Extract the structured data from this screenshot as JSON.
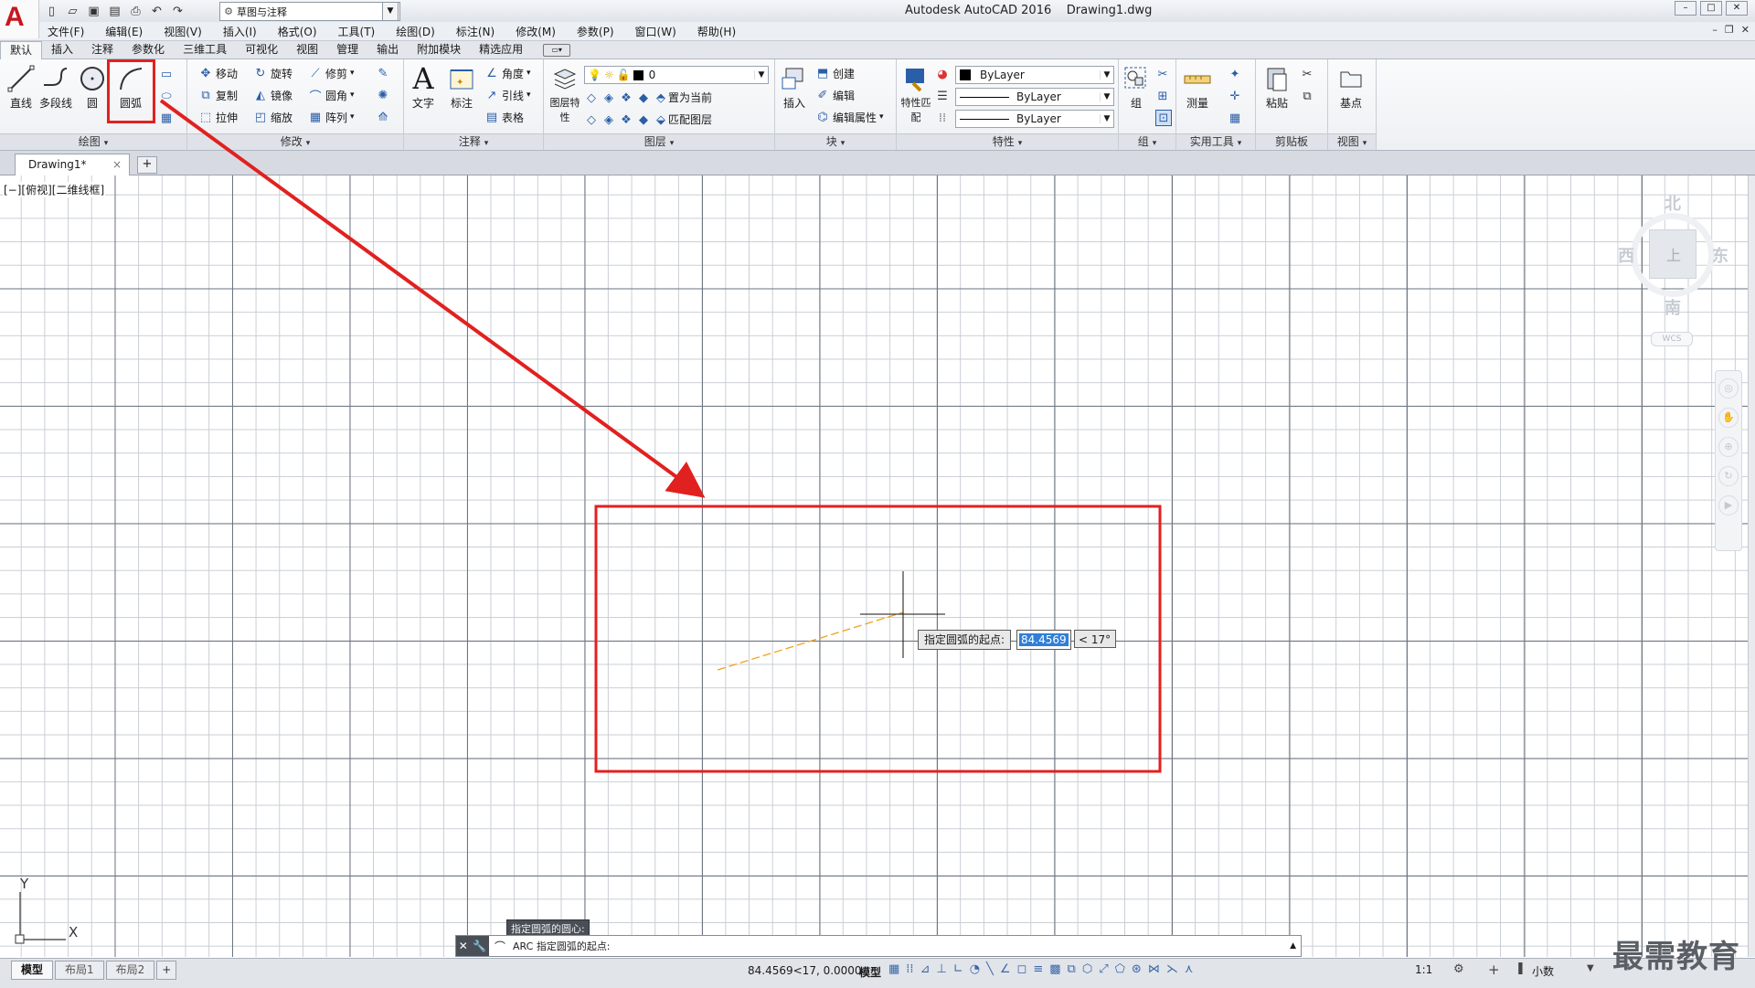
{
  "titlebar": {
    "app_title": "Autodesk AutoCAD 2016    Drawing1.dwg",
    "workspace": "草图与注释",
    "logo": "A"
  },
  "menu": [
    "文件(F)",
    "编辑(E)",
    "视图(V)",
    "插入(I)",
    "格式(O)",
    "工具(T)",
    "绘图(D)",
    "标注(N)",
    "修改(M)",
    "参数(P)",
    "窗口(W)",
    "帮助(H)"
  ],
  "ribbon_tabs": [
    "默认",
    "插入",
    "注释",
    "参数化",
    "三维工具",
    "可视化",
    "视图",
    "管理",
    "输出",
    "附加模块",
    "精选应用"
  ],
  "panels": {
    "draw": {
      "title": "绘图",
      "line": "直线",
      "polyline": "多段线",
      "circle": "圆",
      "arc": "圆弧"
    },
    "modify": {
      "title": "修改",
      "move": "移动",
      "rotate": "旋转",
      "trim": "修剪",
      "copy": "复制",
      "mirror": "镜像",
      "fillet": "圆角",
      "stretch": "拉伸",
      "scale": "缩放",
      "array": "阵列"
    },
    "annotation": {
      "title": "注释",
      "text": "文字",
      "dimension": "标注",
      "angle": "角度",
      "leader": "引线",
      "table": "表格"
    },
    "layers": {
      "title": "图层",
      "layer_props": "图层特性",
      "current_layer": "0",
      "set_current": "置为当前",
      "match_layer": "匹配图层"
    },
    "block": {
      "title": "块",
      "insert": "插入",
      "create": "创建",
      "edit": "编辑",
      "edit_attr": "编辑属性"
    },
    "properties": {
      "title": "特性",
      "match": "特性匹配",
      "color": "ByLayer",
      "linetype": "ByLayer",
      "lineweight": "ByLayer"
    },
    "group": {
      "title": "组",
      "group": "组"
    },
    "utilities": {
      "title": "实用工具",
      "measure": "测量"
    },
    "clipboard": {
      "title": "剪贴板",
      "paste": "粘贴"
    },
    "view": {
      "title": "视图",
      "base": "基点"
    }
  },
  "filetab": {
    "name": "Drawing1*",
    "close": "×",
    "new": "+"
  },
  "viewport_label": "[−][俯视][二维线框]",
  "viewcube": {
    "north": "北",
    "south": "南",
    "east": "东",
    "west": "西",
    "face": "上",
    "wcs": "WCS"
  },
  "dynamic_input": {
    "prompt": "指定圆弧的起点:",
    "value": "84.4569",
    "angle": "< 17°"
  },
  "command": {
    "history": "指定圆弧的圆心:",
    "current": "ARC  指定圆弧的起点:"
  },
  "ucs": {
    "x": "X",
    "y": "Y"
  },
  "layout_tabs": [
    "模型",
    "布局1",
    "布局2"
  ],
  "status": {
    "coords": "84.4569<17, 0.0000",
    "model": "模型",
    "scale": "1:1",
    "units": "小数"
  },
  "watermark": "最需教育",
  "colors": {
    "highlight_red": "#e1211f",
    "rubber_band": "#f0a020",
    "selection_blue": "#2f7fd8"
  }
}
